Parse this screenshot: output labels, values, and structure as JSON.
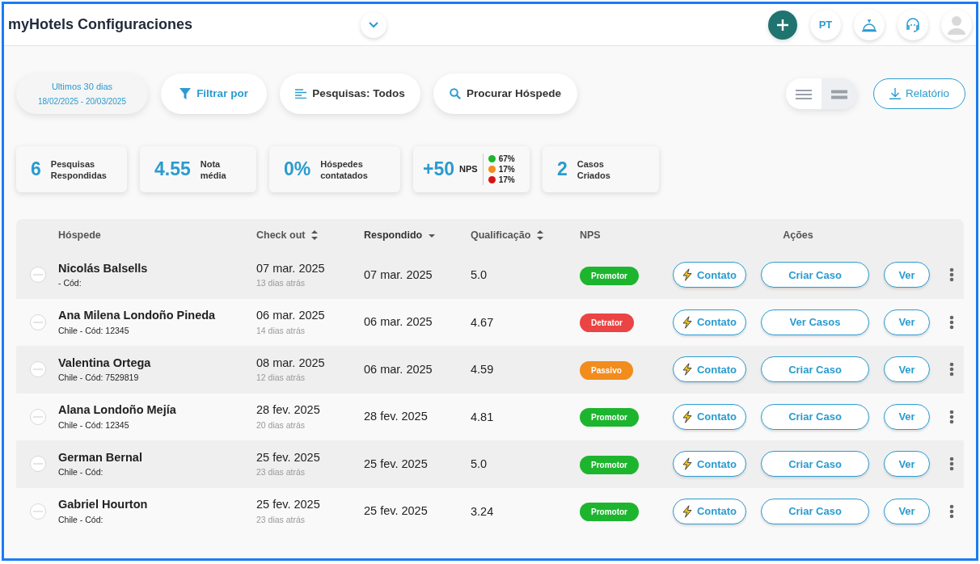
{
  "header": {
    "title": "myHotels Configuraciones",
    "language": "PT"
  },
  "filters": {
    "date_range": {
      "label": "Ultimos 30 dias",
      "dates": "18/02/2025 - 20/03/2025"
    },
    "filter_button": "Filtrar por",
    "surveys_button": "Pesquisas: Todos",
    "search_button": "Procurar Hóspede",
    "view_toggle": [
      {
        "kind": "list",
        "selected": false
      },
      {
        "kind": "compact",
        "selected": true
      }
    ],
    "report_button": "Relatório"
  },
  "stats": [
    {
      "kind": "simple",
      "value": "6",
      "label": "Pesquisas Respondidas"
    },
    {
      "kind": "simple",
      "value": "4.55",
      "label": "Nota média"
    },
    {
      "kind": "simple",
      "value": "0%",
      "label": "Hóspedes contatados"
    },
    {
      "kind": "nps",
      "value": "+50",
      "label": "NPS",
      "breakdown": [
        {
          "color": "#1db52e",
          "percent": "67%"
        },
        {
          "color": "#f28c1c",
          "percent": "17%"
        },
        {
          "color": "#d61414",
          "percent": "17%"
        }
      ]
    },
    {
      "kind": "simple",
      "value": "2",
      "label": "Casos Criados"
    }
  ],
  "table": {
    "columns": [
      {
        "label": "Hóspede",
        "kind": "plain"
      },
      {
        "label": "Check out",
        "kind": "sortable",
        "sorted": false
      },
      {
        "label": "Respondido",
        "kind": "sortable",
        "sorted": true
      },
      {
        "label": "Qualificação",
        "kind": "sortable",
        "sorted": false
      },
      {
        "label": "NPS",
        "kind": "plain"
      },
      {
        "label": "Ações",
        "kind": "plain"
      }
    ],
    "rows": [
      {
        "checked": false,
        "name": "Nicolás Balsells",
        "code": "- Cód:",
        "checkout": "07 mar. 2025",
        "ago": "13 dias atrás",
        "answered": "07 mar. 2025",
        "score": "5.0",
        "nps": "Promotor",
        "color": "#1db52e",
        "contact": "Contato",
        "case": "Criar Caso",
        "view": "Ver"
      },
      {
        "checked": false,
        "name": "Ana Milena Londoño Pineda",
        "code": "Chile - Cód: 12345",
        "checkout": "06 mar. 2025",
        "ago": "14 dias atrás",
        "answered": "06 mar. 2025",
        "score": "4.67",
        "nps": "Detrator",
        "color": "#ea4444",
        "contact": "Contato",
        "case": "Ver Casos",
        "view": "Ver"
      },
      {
        "checked": false,
        "name": "Valentina Ortega",
        "code": "Chile - Cód: 7529819",
        "checkout": "08 mar. 2025",
        "ago": "12 dias atrás",
        "answered": "06 mar. 2025",
        "score": "4.59",
        "nps": "Passivo",
        "color": "#f28c1c",
        "contact": "Contato",
        "case": "Criar Caso",
        "view": "Ver"
      },
      {
        "checked": false,
        "name": "Alana Londoño Mejía",
        "code": "Chile - Cód: 12345",
        "checkout": "28 fev. 2025",
        "ago": "20 dias atrás",
        "answered": "28 fev. 2025",
        "score": "4.81",
        "nps": "Promotor",
        "color": "#1db52e",
        "contact": "Contato",
        "case": "Criar Caso",
        "view": "Ver"
      },
      {
        "checked": false,
        "name": "German Bernal",
        "code": "Chile - Cód:",
        "checkout": "25 fev. 2025",
        "ago": "23 dias atrás",
        "answered": "25 fev. 2025",
        "score": "5.0",
        "nps": "Promotor",
        "color": "#1db52e",
        "contact": "Contato",
        "case": "Criar Caso",
        "view": "Ver"
      },
      {
        "checked": false,
        "name": "Gabriel Hourton",
        "code": "Chile - Cód:",
        "checkout": "25 fev. 2025",
        "ago": "23 dias atrás",
        "answered": "25 fev. 2025",
        "score": "3.24",
        "nps": "Promotor",
        "color": "#1db52e",
        "contact": "Contato",
        "case": "Criar Caso",
        "view": "Ver"
      }
    ]
  }
}
